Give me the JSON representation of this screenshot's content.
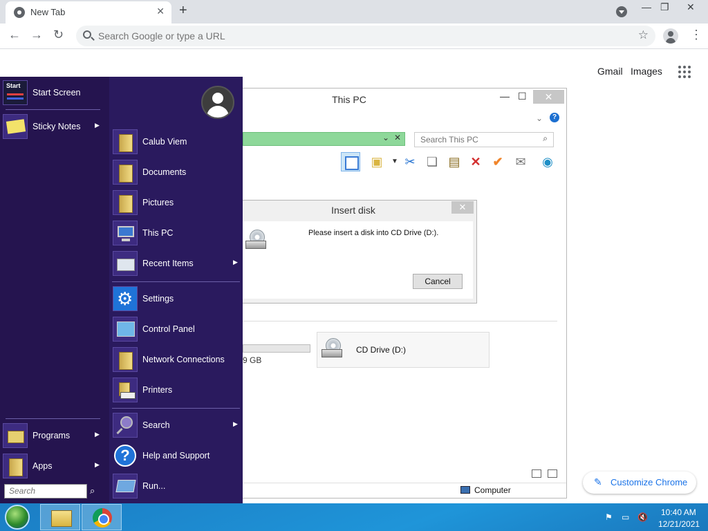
{
  "browser": {
    "tab_title": "New Tab",
    "omnibox_placeholder": "Search Google or type a URL",
    "links": [
      "Gmail",
      "Images"
    ],
    "customize_label": "Customize Chrome"
  },
  "explorer": {
    "title": "This PC",
    "search_placeholder": "Search This PC",
    "drive_c_size_suffix": "9 GB",
    "cd_drive_label": "CD Drive (D:)",
    "status_location": "Computer"
  },
  "dialog": {
    "title": "Insert disk",
    "message": "Please insert a disk into CD Drive (D:).",
    "cancel_label": "Cancel"
  },
  "start_menu": {
    "left_items": [
      {
        "label": "Start Screen",
        "icon": "start-screen-icon"
      },
      {
        "label": "Sticky Notes",
        "icon": "sticky-notes-icon",
        "submenu": true
      },
      {
        "label": "Programs",
        "icon": "programs-icon",
        "submenu": true
      },
      {
        "label": "Apps",
        "icon": "apps-icon",
        "submenu": true
      }
    ],
    "start_tile_label": "Start",
    "right_items": [
      {
        "label": "Calub Viem",
        "icon": "user-folder-icon"
      },
      {
        "label": "Documents",
        "icon": "documents-folder-icon"
      },
      {
        "label": "Pictures",
        "icon": "pictures-folder-icon"
      },
      {
        "label": "This PC",
        "icon": "computer-icon"
      },
      {
        "label": "Recent Items",
        "icon": "recent-items-icon",
        "submenu": true
      },
      {
        "label": "Settings",
        "icon": "settings-gear-icon"
      },
      {
        "label": "Control Panel",
        "icon": "control-panel-icon"
      },
      {
        "label": "Network Connections",
        "icon": "network-connections-icon"
      },
      {
        "label": "Printers",
        "icon": "printer-icon"
      },
      {
        "label": "Search",
        "icon": "search-magnifier-icon",
        "submenu": true
      },
      {
        "label": "Help and Support",
        "icon": "help-icon"
      },
      {
        "label": "Run...",
        "icon": "run-icon"
      }
    ],
    "search_placeholder": "Search"
  },
  "taskbar": {
    "time": "10:40 AM",
    "date": "12/21/2021"
  },
  "colors": {
    "start_menu_bg": "#2a1a5e",
    "taskbar": "#1f95d9",
    "chrome_accent": "#1a73e8"
  }
}
